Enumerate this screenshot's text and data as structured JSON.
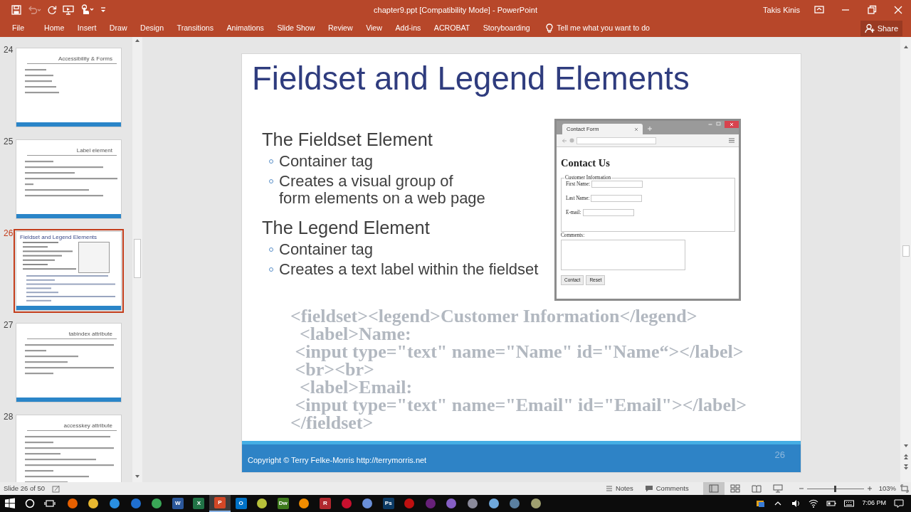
{
  "window": {
    "title": "chapter9.ppt [Compatibility Mode] - PowerPoint",
    "user": "Takis Kinis"
  },
  "quick_access": [
    {
      "kind": "save",
      "disabled": false
    },
    {
      "kind": "undo",
      "disabled": true
    },
    {
      "kind": "repeat",
      "disabled": false
    },
    {
      "kind": "slideshow",
      "disabled": false
    },
    {
      "kind": "touch",
      "disabled": false
    },
    {
      "kind": "customize",
      "disabled": false
    }
  ],
  "ribbon_tabs": [
    "File",
    "Home",
    "Insert",
    "Draw",
    "Design",
    "Transitions",
    "Animations",
    "Slide Show",
    "Review",
    "View",
    "Add-ins",
    "ACROBAT",
    "Storyboarding"
  ],
  "tell_me": "Tell me what you want to do",
  "share": "Share",
  "thumbnails": [
    {
      "number": "24",
      "selected": false,
      "kind": "right-title",
      "title": "Accessibility & Forms",
      "footer": true
    },
    {
      "number": "25",
      "selected": false,
      "kind": "right-title",
      "title": "Label element",
      "footer": true
    },
    {
      "number": "26",
      "selected": true,
      "kind": "left-title",
      "title": "Fieldset and Legend Elements",
      "screenshot": true,
      "footer": true
    },
    {
      "number": "27",
      "selected": false,
      "kind": "right-title",
      "title": "tabindex attribute",
      "footer": true
    },
    {
      "number": "28",
      "selected": false,
      "kind": "right-title",
      "title": "accesskey attribute"
    }
  ],
  "slide": {
    "title": "Fieldset and Legend Elements",
    "sections": [
      {
        "heading": "The Fieldset Element",
        "bullets": [
          "Container tag",
          "Creates a visual group of\nform elements on a web page"
        ]
      },
      {
        "heading": "The Legend Element",
        "bullets": [
          "Container tag",
          "Creates a text label within the fieldset"
        ]
      }
    ],
    "screenshot": {
      "tab": "Contact Form",
      "heading": "Contact Us",
      "legend": "Customer Information",
      "fields": [
        "First Name:",
        "Last Name:",
        "E-mail:"
      ],
      "comments": "Comments:",
      "buttons": [
        "Contact",
        "Reset"
      ]
    },
    "code": [
      "<fieldset><legend>Customer Information</legend>",
      "  <label>Name:",
      " <input type=\"text\" name=\"Name\" id=\"Name“></label>",
      " <br><br>",
      "  <label>Email:",
      " <input type=\"text\" name=\"Email\" id=\"Email\"></label>",
      "</fieldset>"
    ],
    "footer": "Copyright © Terry Felke-Morris http://terrymorris.net",
    "number": "26"
  },
  "status_bar": {
    "slide_info": "Slide 26 of 50",
    "notes": "Notes",
    "comments": "Comments",
    "views": [
      {
        "kind": "normal",
        "selected": true
      },
      {
        "kind": "sorter",
        "selected": false
      },
      {
        "kind": "reading",
        "selected": false
      },
      {
        "kind": "slideshow",
        "selected": false
      }
    ],
    "zoom": {
      "level": 0.5,
      "reading": "103%"
    }
  },
  "taskbar": {
    "apps": [
      {
        "color": "#e66000",
        "selected": false
      },
      {
        "color": "#e8b830",
        "selected": false
      },
      {
        "color": "#2a8fe0",
        "selected": false
      },
      {
        "color": "#1f6fd0",
        "selected": false
      },
      {
        "color": "#3aa757",
        "selected": false
      },
      {
        "color": "#2b579a",
        "glyph": "W",
        "selected": false
      },
      {
        "color": "#217346",
        "glyph": "X",
        "selected": false
      },
      {
        "color": "#d24726",
        "glyph": "P",
        "selected": true
      },
      {
        "color": "#0072c6",
        "glyph": "O",
        "selected": false
      },
      {
        "color": "#b8c23a",
        "selected": false
      },
      {
        "color": "#3e7a1c",
        "glyph": "Dw",
        "selected": false
      },
      {
        "color": "#f08c00",
        "selected": false
      },
      {
        "color": "#b0282e",
        "glyph": "R",
        "selected": false
      },
      {
        "color": "#c8102e",
        "selected": false
      },
      {
        "color": "#6a8fd8",
        "selected": false
      },
      {
        "color": "#0b3a64",
        "glyph": "Ps",
        "selected": false
      },
      {
        "color": "#bf1010",
        "selected": false
      },
      {
        "color": "#68217a",
        "selected": false
      },
      {
        "color": "#865fc5",
        "selected": false
      },
      {
        "color": "#8a8a9a",
        "selected": false
      },
      {
        "color": "#6fa8dc",
        "selected": false
      },
      {
        "color": "#5a7fa0",
        "selected": false
      },
      {
        "color": "#a0a070",
        "selected": false
      }
    ],
    "clock": "7:06 PM"
  }
}
